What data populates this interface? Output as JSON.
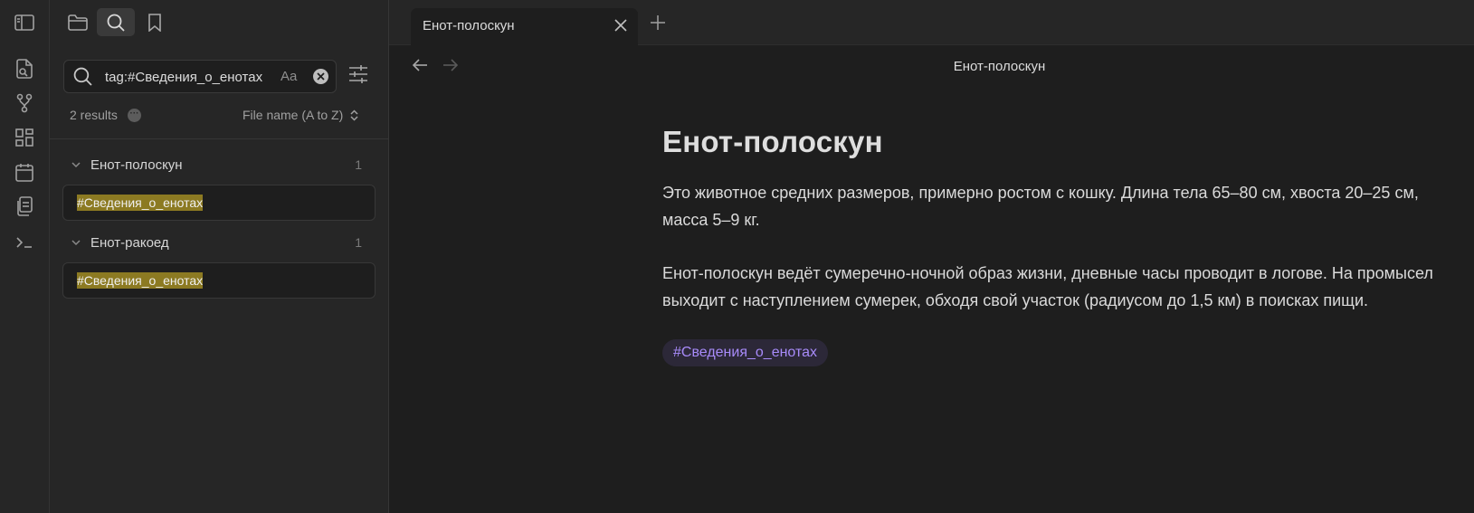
{
  "ribbon": {
    "icons": [
      "open-quick-switcher-icon",
      "graph-view-icon",
      "canvas-icon",
      "daily-note-icon",
      "templates-icon",
      "command-palette-icon"
    ]
  },
  "sidebar": {
    "toggle_icon": "sidebar-toggle-icon",
    "tabs": [
      "files-icon",
      "search-icon",
      "bookmarks-icon"
    ],
    "search": {
      "query": "tag:#Сведения_о_енотах",
      "match_case_label": "Aa"
    },
    "results_count": "2 results",
    "sort_label": "File name (A to Z)",
    "results": [
      {
        "file": "Енот-полоскун",
        "count": "1",
        "match": "#Сведения_о_енотах"
      },
      {
        "file": "Енот-ракоед",
        "count": "1",
        "match": "#Сведения_о_енотах"
      }
    ]
  },
  "tabbar": {
    "active_tab": "Енот-полоскун"
  },
  "editor": {
    "view_title": "Енот-полоскун",
    "heading": "Енот-полоскун",
    "paragraphs": [
      "Это животное средних размеров, примерно ростом с кошку. Длина тела 65–80 см, хвоста 20–25 см, масса 5–9 кг.",
      "Енот-полоскун ведёт сумеречно-ночной образ жизни, дневные часы проводит в логове. На промысел выходит с наступлением сумерек, обходя свой участок (радиусом до 1,5 км) в поисках пищи."
    ],
    "tag": "#Сведения_о_енотах"
  },
  "colors": {
    "background": "#1e1e1e",
    "sidebar": "#262626",
    "highlight": "#8c7a22",
    "tag_text": "#a88bfa",
    "tag_bg": "#2c2838"
  }
}
